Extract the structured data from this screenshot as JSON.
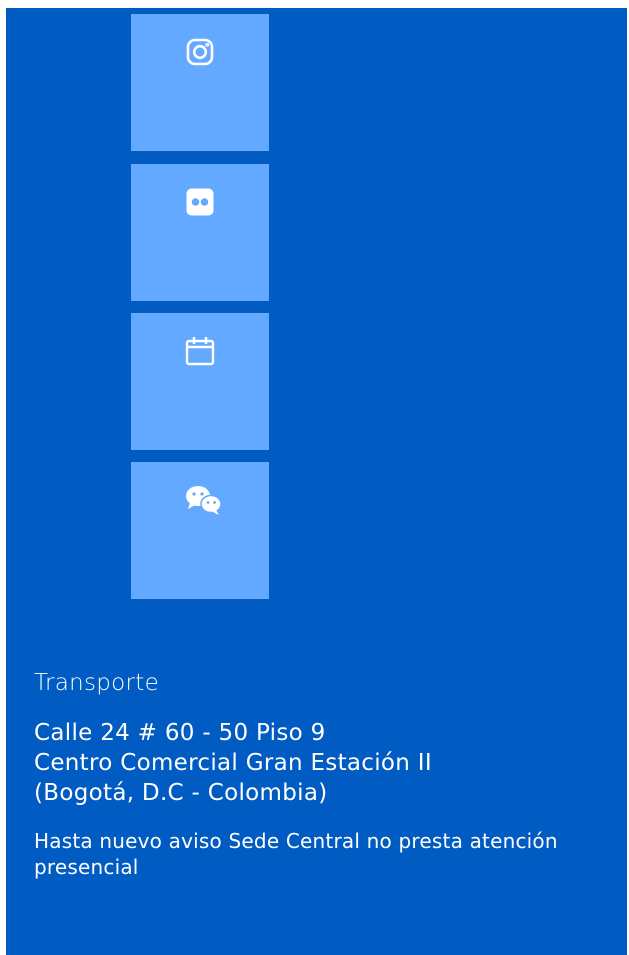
{
  "social_tiles": [
    {
      "icon": "instagram-icon"
    },
    {
      "icon": "flickr-icon"
    },
    {
      "icon": "calendar-icon"
    },
    {
      "icon": "wechat-icon"
    }
  ],
  "footer": {
    "heading": "Transporte",
    "address_lines": [
      "Calle 24 # 60 - 50 Piso 9",
      "Centro Comercial Gran Estación II",
      "(Bogotá, D.C - Colombia)"
    ],
    "notice": "Hasta nuevo aviso Sede Central no presta atención presencial"
  },
  "colors": {
    "panel_background": "#005bc2",
    "tile_background": "#63a9ff",
    "text": "#ffffff"
  }
}
